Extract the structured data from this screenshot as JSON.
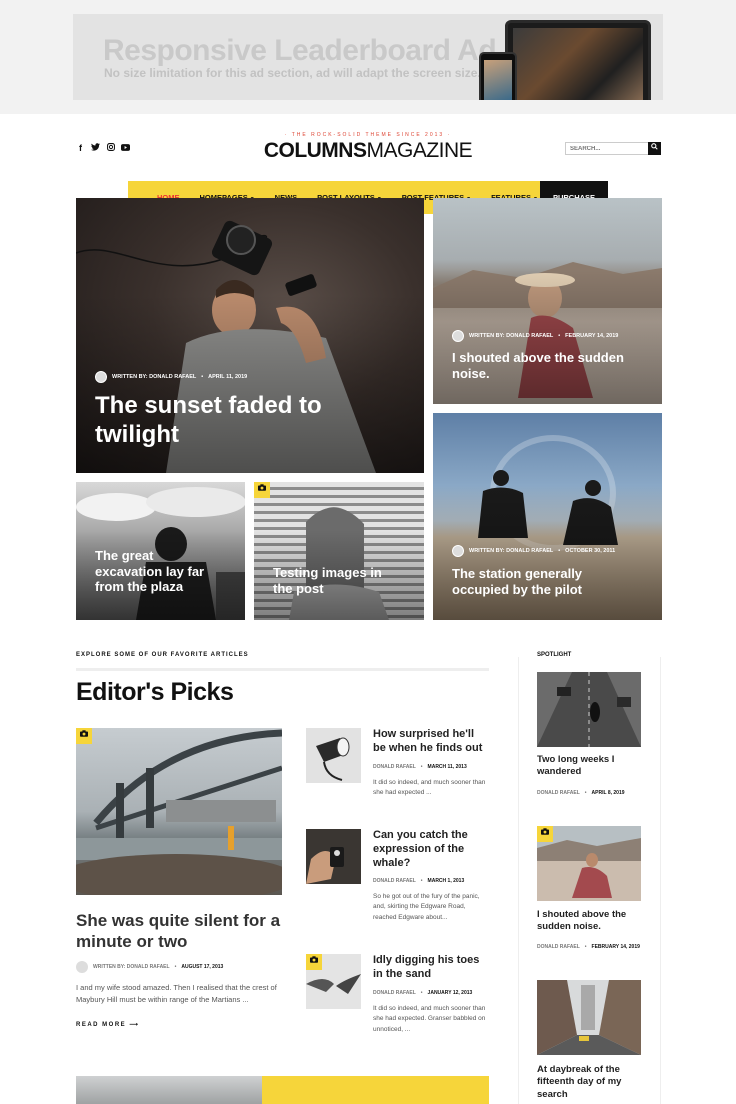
{
  "ad": {
    "title": "Responsive Leaderboard Ad",
    "subtitle": "No size limitation for this ad section, ad will adapt the screen size."
  },
  "header": {
    "tagline": "· THE ROCK-SOLID THEME SINCE 2013 ·",
    "logo_bold": "COLUMNS",
    "logo_light": "MAGAZINE",
    "search_placeholder": "SEARCH...",
    "social_icons": [
      "facebook-icon",
      "twitter-icon",
      "instagram-icon",
      "youtube-icon"
    ]
  },
  "nav": {
    "items": [
      {
        "label": "HOME",
        "caret": false
      },
      {
        "label": "HOMEPAGES",
        "caret": true
      },
      {
        "label": "NEWS",
        "caret": false
      },
      {
        "label": "POST LAYOUTS",
        "caret": true
      },
      {
        "label": "POST FEATURES",
        "caret": true
      },
      {
        "label": "FEATURES",
        "caret": true
      }
    ],
    "purchase": "PURCHASE",
    "accent": "#f6d53a",
    "active_color": "#e33333"
  },
  "hero": {
    "main": {
      "title": "The sunset faded to twilight",
      "author": "WRITTEN BY: DONALD RAFAEL",
      "date": "APRIL 11, 2019"
    },
    "top_right": {
      "title": "I shouted above the sudden noise.",
      "author": "WRITTEN BY: DONALD RAFAEL",
      "date": "FEBRUARY 14, 2019"
    },
    "bottom_left": {
      "title": "The great excavation lay far from the plaza"
    },
    "bottom_mid": {
      "title": "Testing images in the post"
    },
    "bottom_right": {
      "title": "The station generally occupied by the pilot",
      "author": "WRITTEN BY: DONALD RAFAEL",
      "date": "OCTOBER 30, 2011"
    }
  },
  "editors": {
    "kicker": "EXPLORE SOME OF OUR FAVORITE ARTICLES",
    "title": "Editor's Picks",
    "featured": {
      "title": "She was quite silent for a minute or two",
      "author": "WRITTEN BY: DONALD RAFAEL",
      "date": "AUGUST 17, 2013",
      "excerpt": "I and my wife stood amazed. Then I realised that the crest of Maybury Hill must be within range of the Martians ...",
      "read_more": "READ MORE ⟶"
    },
    "list": [
      {
        "title": "How surprised he'll be when he finds out",
        "author": "DONALD RAFAEL",
        "date": "MARCH 11, 2013",
        "excerpt": "It did so indeed, and much sooner than she had expected ..."
      },
      {
        "title": "Can you catch the expression of the whale?",
        "author": "DONALD RAFAEL",
        "date": "MARCH 1, 2013",
        "excerpt": "So he got out of the fury of the panic, and, skirting the Edgware Road, reached Edgware about..."
      },
      {
        "title": "Idly digging his toes in the sand",
        "author": "DONALD RAFAEL",
        "date": "JANUARY 12, 2013",
        "excerpt": "It did so indeed, and much sooner than she had expected. Granser babbled on unnoticed, ..."
      }
    ]
  },
  "sidebar": {
    "title": "SPOTLIGHT",
    "items": [
      {
        "title": "Two long weeks I wandered",
        "author": "DONALD RAFAEL",
        "date": "APRIL 8, 2019"
      },
      {
        "title": "I shouted above the sudden noise.",
        "author": "DONALD RAFAEL",
        "date": "FEBRUARY 14, 2019"
      },
      {
        "title": "At daybreak of the fifteenth day of my search"
      }
    ]
  }
}
